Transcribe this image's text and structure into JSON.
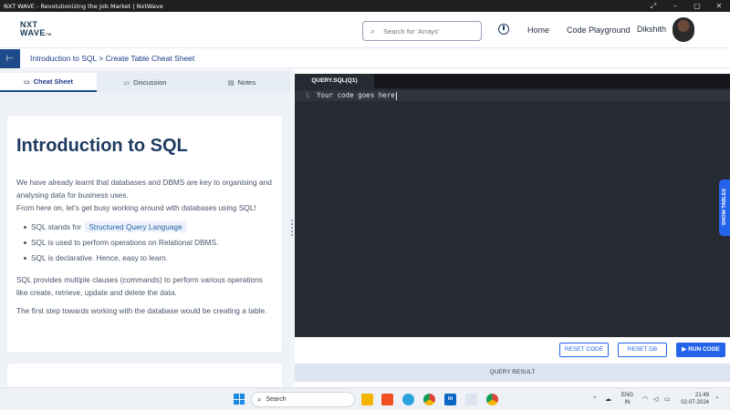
{
  "window": {
    "title": "NXT WAVE - Revolutionizing the Job Market | NxtWave"
  },
  "header": {
    "logo_line1": "NXT",
    "logo_line2": "WAVE",
    "logo_tm": "TM",
    "search_placeholder": "Search for 'Arrays'",
    "nav_home": "Home",
    "nav_code_playground": "Code Playground",
    "username": "Dikshith"
  },
  "breadcrumb": {
    "text": "Introduction to SQL > Create Table Cheat Sheet"
  },
  "tabs": [
    {
      "label": "Cheat Sheet",
      "active": true
    },
    {
      "label": "Discussion",
      "active": false
    },
    {
      "label": "Notes",
      "active": false
    }
  ],
  "content": {
    "title": "Introduction to SQL",
    "para1": "We have already learnt that databases and DBMS are key to organising and analysing data for business uses.",
    "para2": "From here on, let's get busy working around with databases using SQL!",
    "bullet1_prefix": "SQL stands for",
    "bullet1_highlight": "Structured Query Language",
    "bullet2": "SQL is used to perform operations on Relational DBMS.",
    "bullet3": "SQL is declarative. Hence, easy to learn.",
    "para3": "SQL provides multiple clauses (commands) to perform various operations like create, retrieve, update and delete the data.",
    "para4": "The first step towards working with the database would be creating a table."
  },
  "editor": {
    "tab_label": "QUERY.SQL(Q1)",
    "line_number": "1",
    "code": "Your code goes here",
    "show_tables": "SHOW TABLES"
  },
  "actions": {
    "reset_code": "RESET CODE",
    "reset_db": "RESET DB",
    "run_code": "RUN CODE",
    "query_result": "QUERY RESULT"
  },
  "taskbar": {
    "search_label": "Search",
    "lang_line1": "ENG",
    "lang_line2": "IN",
    "time": "21:49",
    "date": "02-07-2024"
  },
  "colors": {
    "accent": "#2563eb",
    "header_dark": "#1e4a8a",
    "editor_bg": "#262a33"
  }
}
